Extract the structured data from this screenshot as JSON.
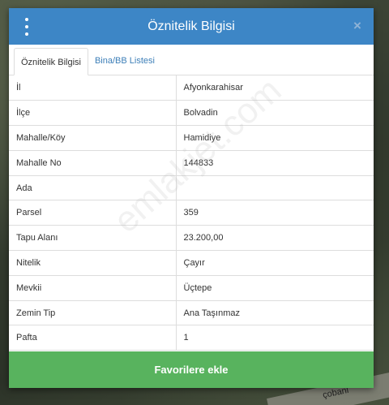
{
  "dialog": {
    "title": "Öznitelik Bilgisi",
    "close_glyph": "×"
  },
  "tabs": [
    {
      "label": "Öznitelik Bilgisi",
      "active": true
    },
    {
      "label": "Bina/BB Listesi",
      "active": false
    }
  ],
  "attributes": [
    {
      "key": "İl",
      "value": "Afyonkarahisar"
    },
    {
      "key": "İlçe",
      "value": "Bolvadin"
    },
    {
      "key": "Mahalle/Köy",
      "value": "Hamidiye"
    },
    {
      "key": "Mahalle No",
      "value": "144833"
    },
    {
      "key": "Ada",
      "value": ""
    },
    {
      "key": "Parsel",
      "value": "359"
    },
    {
      "key": "Tapu Alanı",
      "value": "23.200,00"
    },
    {
      "key": "Nitelik",
      "value": "Çayır"
    },
    {
      "key": "Mevkii",
      "value": "Üçtepe"
    },
    {
      "key": "Zemin Tip",
      "value": "Ana Taşınmaz"
    },
    {
      "key": "Pafta",
      "value": "1"
    }
  ],
  "favorite_button": "Favorilere ekle",
  "watermark": "emlakjet.com",
  "map": {
    "road_label": "çobanl"
  },
  "colors": {
    "header": "#3d86c6",
    "favorite": "#58b35e",
    "tab_link": "#3d7fb8"
  },
  "icons": {
    "menu": "vertical-dots-icon",
    "close": "close-icon"
  }
}
